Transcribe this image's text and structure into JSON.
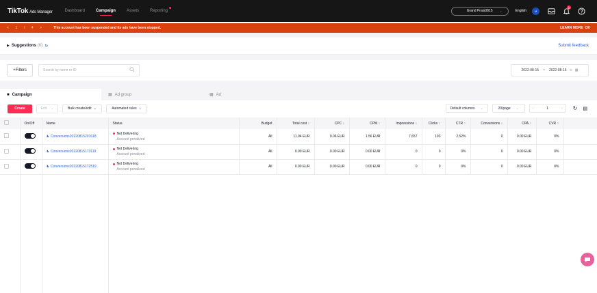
{
  "app": {
    "logo": "TikTok",
    "logo_suffix": "Ads Manager"
  },
  "nav": [
    {
      "label": "Dashboard",
      "active": false
    },
    {
      "label": "Campaign",
      "active": true
    },
    {
      "label": "Assets",
      "active": false
    },
    {
      "label": "Reporting",
      "active": false
    }
  ],
  "account": {
    "name": "Grand Prais0815",
    "language": "English",
    "avatar_initial": "M",
    "notification_count": "8"
  },
  "alert": {
    "pager": {
      "prev": "<",
      "current": "1",
      "sep": "/",
      "total": "4",
      "next": ">"
    },
    "message": "This account has been suspended and its ads have been stopped.",
    "links": "LEARN MORE  OK"
  },
  "suggestions": {
    "label": "Suggestions",
    "count": "(0)",
    "feedback": "Submit feedback"
  },
  "filters": {
    "button": "+Filters",
    "search_placeholder": "Search by name or ID",
    "date_start": "2022-08-15",
    "date_sep": "~",
    "date_end": "2022-08-15"
  },
  "tabs": [
    {
      "label": "Campaign"
    },
    {
      "label": "Ad group"
    },
    {
      "label": "Ad"
    }
  ],
  "toolbar": {
    "create": "Create",
    "edit": "Edit",
    "bulk": "Bulk create/edit",
    "rules": "Automated rules",
    "columns": "Default columns",
    "page_size": "20/page",
    "page_num": "1"
  },
  "table": {
    "headers": {
      "onoff": "On/Off",
      "name": "Name",
      "status": "Status",
      "budget": "Budget",
      "total_cost": "Total cost",
      "cpc": "CPC",
      "cpm": "CPM",
      "impressions": "Impressions",
      "clicks": "Clicks",
      "ctr": "CTR",
      "conversions": "Conversions",
      "cpa": "CPA",
      "cvr": "CVR"
    },
    "rows": [
      {
        "name": "Conversions20220815201618",
        "status": "Not Delivering",
        "status_sub": "Account penalized",
        "budget": "All",
        "total_cost": "11.94 EUR",
        "cpc": "0.06 EUR",
        "cpm": "1.56 EUR",
        "impressions": "7,657",
        "clicks": "193",
        "ctr": "2.52%",
        "conversions": "0",
        "cpa": "0.00 EUR",
        "cvr": "0%"
      },
      {
        "name": "Conversions20220815173119",
        "status": "Not Delivering",
        "status_sub": "Account penalized",
        "budget": "All",
        "total_cost": "0.00 EUR",
        "cpc": "0.00 EUR",
        "cpm": "0.00 EUR",
        "impressions": "0",
        "clicks": "0",
        "ctr": "0%",
        "conversions": "0",
        "cpa": "0.00 EUR",
        "cvr": "0%"
      },
      {
        "name": "Conversions20220815172519",
        "status": "Not Delivering",
        "status_sub": "Account penalized",
        "budget": "All",
        "total_cost": "0.00 EUR",
        "cpc": "0.00 EUR",
        "cpm": "0.00 EUR",
        "impressions": "0",
        "clicks": "0",
        "ctr": "0%",
        "conversions": "0",
        "cpa": "0.00 EUR",
        "cvr": "0%"
      }
    ]
  },
  "colors": {
    "brand": "#fe2c55",
    "alert_bg": "#d9410e",
    "link": "#2b5dd6",
    "topbar": "#161616"
  }
}
